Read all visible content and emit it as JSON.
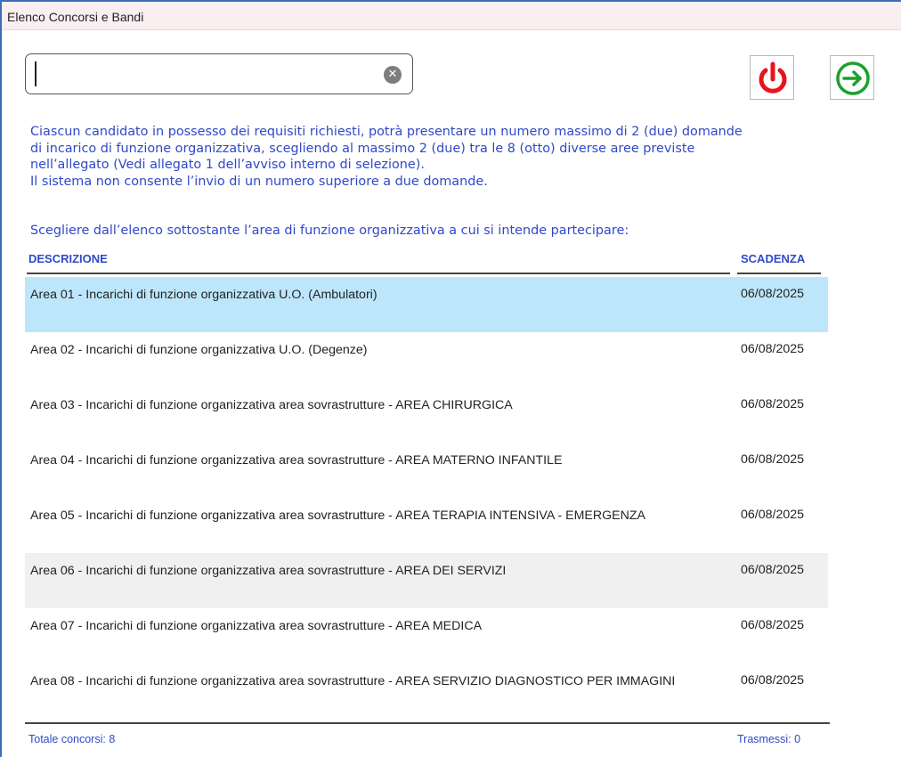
{
  "window": {
    "title": "Elenco Concorsi e Bandi"
  },
  "search": {
    "value": "",
    "placeholder": "",
    "clear_icon": "clear-circle-icon"
  },
  "toolbar": {
    "power_icon": "power-icon",
    "power_color": "#e8141c",
    "enter_icon": "arrow-right-circle-icon",
    "enter_color": "#1aa12b"
  },
  "notice": {
    "lines": [
      "Ciascun candidato in possesso dei requisiti richiesti, potrà presentare un numero massimo di 2 (due) domande",
      "di incarico di funzione organizzativa, scegliendo al massimo 2 (due) tra le 8 (otto) diverse aree previste",
      "nell’allegato (Vedi allegato 1 dell’avviso interno di selezione).",
      "Il sistema non consente l’invio di un numero superiore a due domande."
    ],
    "choose": "Scegliere dall’elenco sottostante l’area di funzione organizzativa a cui si intende partecipare:"
  },
  "table": {
    "columns": {
      "description": "DESCRIZIONE",
      "deadline": "SCADENZA"
    },
    "rows": [
      {
        "description": "Area 01 - Incarichi di funzione organizzativa U.O. (Ambulatori)",
        "deadline": "06/08/2025"
      },
      {
        "description": "Area 02 - Incarichi di funzione organizzativa U.O. (Degenze)",
        "deadline": "06/08/2025"
      },
      {
        "description": "Area 03 - Incarichi di funzione organizzativa area sovrastrutture - AREA CHIRURGICA",
        "deadline": "06/08/2025"
      },
      {
        "description": "Area 04 - Incarichi di funzione organizzativa area sovrastrutture - AREA MATERNO INFANTILE",
        "deadline": "06/08/2025"
      },
      {
        "description": "Area 05 - Incarichi di funzione organizzativa area sovrastrutture - AREA TERAPIA INTENSIVA - EMERGENZA",
        "deadline": "06/08/2025"
      },
      {
        "description": "Area 06 - Incarichi di funzione organizzativa area sovrastrutture - AREA DEI SERVIZI",
        "deadline": "06/08/2025"
      },
      {
        "description": "Area 07 - Incarichi di funzione organizzativa area sovrastrutture - AREA MEDICA",
        "deadline": "06/08/2025"
      },
      {
        "description": "Area 08 - Incarichi di funzione organizzativa area sovrastrutture - AREA SERVIZIO DIAGNOSTICO PER IMMAGINI",
        "deadline": "06/08/2025"
      }
    ],
    "selected_row": 1,
    "highlight_color": "#bde6fb"
  },
  "footer": {
    "total": "Totale concorsi: 8",
    "sent": "Trasmessi: 0"
  },
  "colors": {
    "accent": "#2f49c8",
    "window_border": "#3a6fb8"
  }
}
